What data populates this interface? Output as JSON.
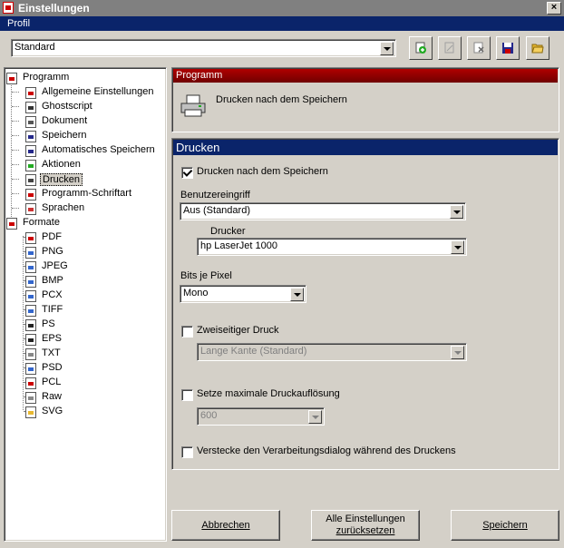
{
  "window": {
    "title": "Einstellungen",
    "close": "×"
  },
  "profile": {
    "bar_label": "Profil",
    "selected": "Standard"
  },
  "tree": {
    "programm": "Programm",
    "items": [
      "Allgemeine Einstellungen",
      "Ghostscript",
      "Dokument",
      "Speichern",
      "Automatisches Speichern",
      "Aktionen",
      "Drucken",
      "Programm-Schriftart",
      "Sprachen"
    ],
    "formate": "Formate",
    "formats": [
      "PDF",
      "PNG",
      "JPEG",
      "BMP",
      "PCX",
      "TIFF",
      "PS",
      "EPS",
      "TXT",
      "PSD",
      "PCL",
      "Raw",
      "SVG"
    ]
  },
  "section_header": "Programm",
  "section_description": "Drucken nach dem Speichern",
  "drucken": {
    "header": "Drucken",
    "print_after_save": "Drucken nach dem Speichern",
    "user_interaction_label": "Benutzereingriff",
    "user_interaction_value": "Aus (Standard)",
    "printer_label": "Drucker",
    "printer_value": "hp LaserJet 1000",
    "bits_label": "Bits je Pixel",
    "bits_value": "Mono",
    "duplex_label": "Zweiseitiger Druck",
    "duplex_value": "Lange Kante (Standard)",
    "max_resolution_label": "Setze maximale Druckauflösung",
    "max_resolution_value": "600",
    "hide_dialog_label": "Verstecke den Verarbeitungsdialog während des Druckens"
  },
  "buttons": {
    "cancel": "Abbrechen",
    "reset_line1": "Alle Einstellungen",
    "reset_line2": "zurücksetzen",
    "save": "Speichern"
  },
  "colors": {
    "accent": "#0a246a",
    "header_red": "#b00000"
  }
}
